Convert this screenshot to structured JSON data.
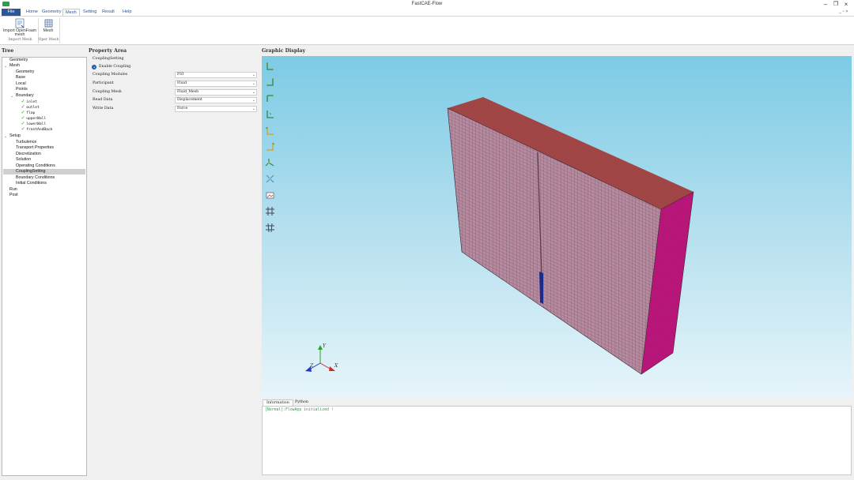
{
  "window": {
    "title": "FastCAE-Flow"
  },
  "ribbon_tabs": [
    {
      "label": "File"
    },
    {
      "label": "Home"
    },
    {
      "label": "Geometry"
    },
    {
      "label": "Mesh"
    },
    {
      "label": "Setting"
    },
    {
      "label": "Result"
    },
    {
      "label": "Help"
    }
  ],
  "ribbon": {
    "import_label": "Import OpenFoam mesh",
    "mesh_label": "Mesh",
    "group_import": "Import Mesh",
    "group_oper": "Oper Mesh"
  },
  "tree": {
    "title": "Tree",
    "items": [
      {
        "label": "Geometry"
      },
      {
        "label": "Mesh"
      },
      {
        "label": "Geometry"
      },
      {
        "label": "Base"
      },
      {
        "label": "Local"
      },
      {
        "label": "Points"
      },
      {
        "label": "Boundary"
      },
      {
        "label": "inlet"
      },
      {
        "label": "outlet"
      },
      {
        "label": "flap"
      },
      {
        "label": "upperWall"
      },
      {
        "label": "lowerWall"
      },
      {
        "label": "frontAndBack"
      },
      {
        "label": "Setup"
      },
      {
        "label": "Turbulence"
      },
      {
        "label": "Transport Properties"
      },
      {
        "label": "Discretization"
      },
      {
        "label": "Solution"
      },
      {
        "label": "Operating Conditions"
      },
      {
        "label": "CouplingSetting"
      },
      {
        "label": "Boundary Conditions"
      },
      {
        "label": "Initial Conditions"
      },
      {
        "label": "Run"
      },
      {
        "label": "Post"
      }
    ]
  },
  "property": {
    "title": "Property Area",
    "section": "CouplingSetting",
    "enable_coupling": "Enable Coupling",
    "rows": [
      {
        "label": "Coupling Modules",
        "value": "FSI"
      },
      {
        "label": "Participant",
        "value": "Fluid"
      },
      {
        "label": "Coupling Mesh",
        "value": "Fluid_Mesh"
      },
      {
        "label": "Read Data",
        "value": "Displacement"
      },
      {
        "label": "Write Data",
        "value": "Force"
      }
    ]
  },
  "graphics": {
    "title": "Graphic Display",
    "axis_labels": {
      "y": "Y",
      "x": "X",
      "z": "Z"
    }
  },
  "info": {
    "tabs": [
      {
        "label": "Information"
      },
      {
        "label": "Python"
      }
    ],
    "message": "[Normal]:FlowApp initialized !"
  },
  "colors": {
    "accent": "#2b579a",
    "mesh_top": "#a84848",
    "mesh_front": "#b88aa0",
    "mesh_side": "#c0177f",
    "flap": "#1a2b8c"
  }
}
